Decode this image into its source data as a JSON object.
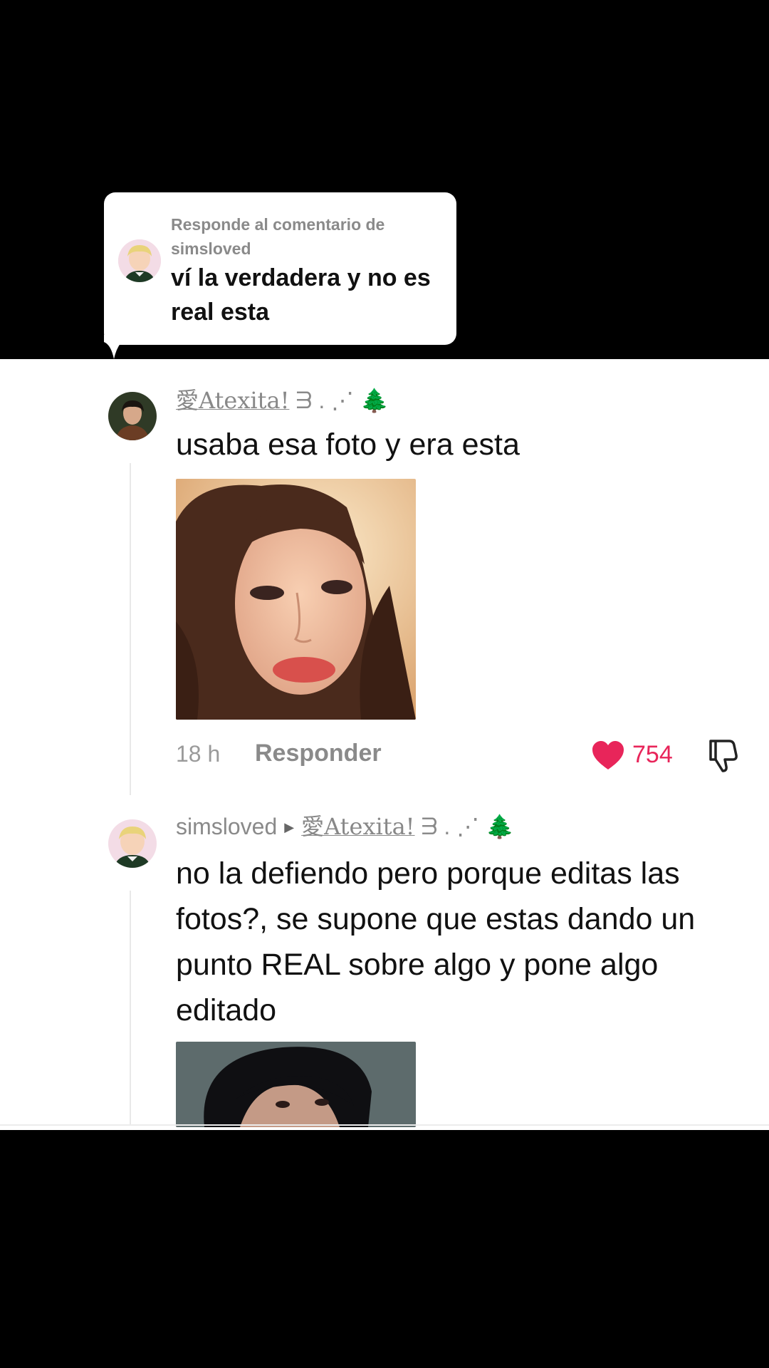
{
  "reply_bubble": {
    "header": "Responde al comentario de simsloved",
    "text": "ví la verdadera y no es real esta"
  },
  "comments": [
    {
      "username_deco": "愛Atexita!",
      "username_suffix": " ᗱ . ⋰ 🌲",
      "text": "usaba esa foto y era esta",
      "time": "18 h",
      "reply_label": "Responder",
      "likes": "754"
    },
    {
      "username": "simsloved",
      "reply_to_deco": "愛Atexita!",
      "reply_to_suffix": " ᗱ . ⋰ 🌲",
      "text": "no la defiendo pero porque editas las fotos?, se supone que estas dando un punto REAL sobre algo y pone algo editado"
    }
  ],
  "colors": {
    "like": "#e8255a",
    "muted": "#8a8a8a",
    "text": "#111111"
  },
  "icons": [
    "heart-icon",
    "dislike-icon"
  ]
}
